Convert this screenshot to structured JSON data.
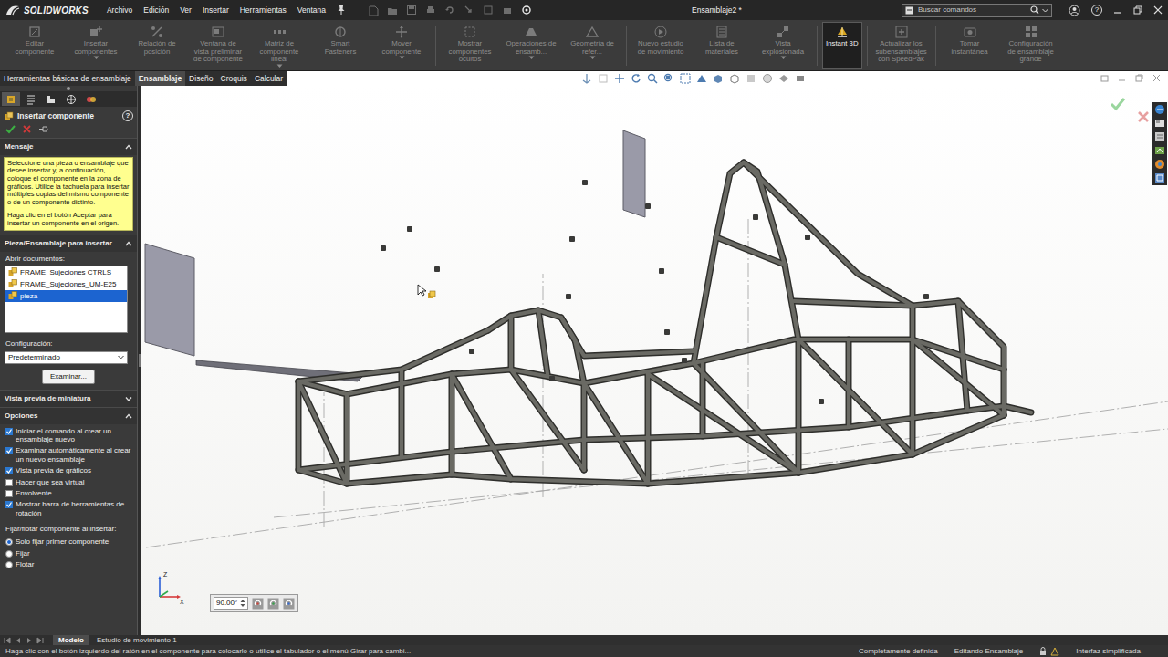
{
  "app": {
    "logo": "SOLIDWORKS",
    "menu": [
      "Archivo",
      "Edición",
      "Ver",
      "Insertar",
      "Herramientas",
      "Ventana"
    ],
    "title": "Ensamblaje2 *",
    "search": {
      "placeholder": "Buscar comandos"
    },
    "help": "?"
  },
  "ribbon": [
    {
      "label": "Editar componente",
      "disabled": true,
      "active": false,
      "dropdown": false
    },
    {
      "label": "Insertar componentes",
      "disabled": true,
      "active": false,
      "dropdown": true
    },
    {
      "label": "Relación de posición",
      "disabled": true,
      "active": false,
      "dropdown": false
    },
    {
      "label": "Ventana de vista preliminar de componente",
      "disabled": true,
      "active": false,
      "dropdown": false
    },
    {
      "label": "Matriz de componente lineal",
      "disabled": true,
      "active": false,
      "dropdown": true
    },
    {
      "label": "Smart Fasteners",
      "disabled": true,
      "active": false,
      "dropdown": false
    },
    {
      "label": "Mover componente",
      "disabled": true,
      "active": false,
      "dropdown": true
    },
    {
      "label": "Mostrar componentes ocultos",
      "disabled": true,
      "active": false,
      "dropdown": false
    },
    {
      "label": "Operaciones de ensamb...",
      "disabled": true,
      "active": false,
      "dropdown": true
    },
    {
      "label": "Geometría de refer...",
      "disabled": true,
      "active": false,
      "dropdown": true
    },
    {
      "label": "Nuevo estudio de movimiento",
      "disabled": true,
      "active": false,
      "dropdown": false
    },
    {
      "label": "Lista de materiales",
      "disabled": true,
      "active": false,
      "dropdown": false
    },
    {
      "label": "Vista explosionada",
      "disabled": true,
      "active": false,
      "dropdown": true
    },
    {
      "label": "Instant 3D",
      "disabled": false,
      "active": true,
      "dropdown": false
    },
    {
      "label": "Actualizar los subensamblajes con SpeedPak",
      "disabled": true,
      "active": false,
      "dropdown": false
    },
    {
      "label": "Tomar instantánea",
      "disabled": true,
      "active": false,
      "dropdown": false
    },
    {
      "label": "Configuración de ensamblaje grande",
      "disabled": true,
      "active": false,
      "dropdown": false
    }
  ],
  "command_tabs": [
    {
      "label": "Herramientas básicas de ensamblaje",
      "selected": false
    },
    {
      "label": "Ensamblaje",
      "selected": true
    },
    {
      "label": "Diseño",
      "selected": false
    },
    {
      "label": "Croquis",
      "selected": false
    },
    {
      "label": "Calcular",
      "selected": false
    }
  ],
  "property_manager": {
    "panel_tabs": [
      {
        "selected": true
      },
      {
        "selected": false
      },
      {
        "selected": false
      },
      {
        "selected": false
      },
      {
        "selected": false
      }
    ],
    "title": "Insertar componente",
    "help": "?",
    "message": {
      "header": "Mensaje",
      "expanded": true,
      "paragraphs": [
        "Seleccione una pieza o ensamblaje que desee insertar y, a continuación, coloque el componente en la zona de gráficos. Utilice la tachuela para insertar múltiples copias del mismo componente o de un componente distinto.",
        "Haga clic en el botón Aceptar para insertar un componente en el origen."
      ]
    },
    "parts": {
      "header": "Pieza/Ensamblaje para insertar",
      "expanded": true,
      "label": "Abrir documentos:",
      "documents": [
        {
          "name": "FRAME_Sujeciones CTRLS",
          "selected": false
        },
        {
          "name": "FRAME_Sujeciones_UM-E25",
          "selected": false
        },
        {
          "name": "pieza",
          "selected": true
        }
      ],
      "config_label": "Configuración:",
      "config_value": "Predeterminado",
      "browse": "Examinar..."
    },
    "thumbnail": {
      "header": "Vista previa de miniatura",
      "expanded": false
    },
    "options": {
      "header": "Opciones",
      "expanded": true,
      "checkboxes": [
        {
          "label": "Iniciar el comando al crear un ensamblaje nuevo",
          "checked": true
        },
        {
          "label": "Examinar automáticamente al crear un nuevo ensamblaje",
          "checked": true
        },
        {
          "label": "Vista previa de gráficos",
          "checked": true
        },
        {
          "label": "Hacer que sea virtual",
          "checked": false
        },
        {
          "label": "Envolvente",
          "checked": false
        },
        {
          "label": "Mostrar barra de herramientas de rotación",
          "checked": true
        }
      ],
      "fix_label": "Fijar/flotar componente al insertar:",
      "fix_options": [
        {
          "label": "Solo fijar primer componente",
          "selected": true
        },
        {
          "label": "Fijar",
          "selected": false
        },
        {
          "label": "Flotar",
          "selected": false
        }
      ]
    }
  },
  "graphics": {
    "rotation_angle": "90.00°",
    "triad_labels": [
      "Z",
      "X"
    ]
  },
  "bottom_tabs": [
    {
      "label": "Modelo",
      "selected": true
    },
    {
      "label": "Estudio de movimiento 1",
      "selected": false
    }
  ],
  "status_bar": {
    "hint": "Haga clic con el botón izquierdo del ratón en el componente para colocarlo o utilice el tabulador o el menú Girar para cambi...",
    "state": "Completamente definida",
    "mode": "Editando Ensamblaje",
    "ui": "Interfaz simplificada"
  }
}
